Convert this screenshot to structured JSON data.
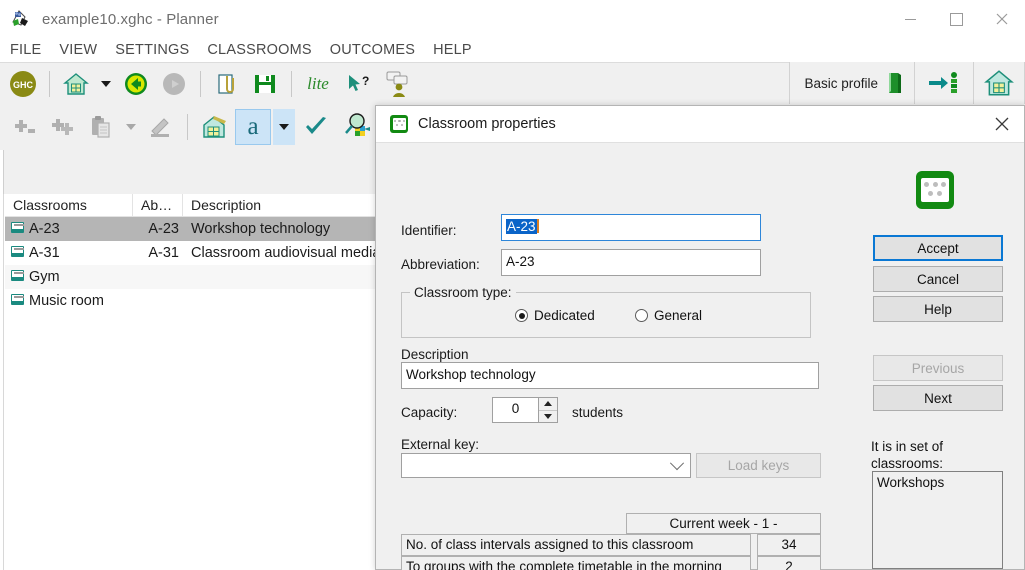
{
  "window": {
    "title": "example10.xghc - Planner",
    "app_icon": "planner-app-icon",
    "controls": {
      "minimize": "minimize",
      "maximize": "maximize",
      "close": "close"
    }
  },
  "menu": {
    "items": [
      {
        "label": "FILE"
      },
      {
        "label": "VIEW"
      },
      {
        "label": "SETTINGS"
      },
      {
        "label": "CLASSROOMS"
      },
      {
        "label": "OUTCOMES"
      },
      {
        "label": "HELP"
      }
    ]
  },
  "toolbar_top": {
    "items": [
      {
        "name": "ghc-logo-button",
        "label": "GHC"
      },
      {
        "name": "home-button",
        "label": ""
      },
      {
        "name": "home-dropdown-caret",
        "label": ""
      },
      {
        "name": "back-button",
        "label": ""
      },
      {
        "name": "forward-button-disabled",
        "label": ""
      },
      {
        "name": "attach-button",
        "label": ""
      },
      {
        "name": "save-button",
        "label": ""
      },
      {
        "name": "lite-button",
        "label": "lite"
      },
      {
        "name": "help-pointer-button",
        "label": ""
      },
      {
        "name": "comments-user-button",
        "label": ""
      }
    ],
    "profile_label": "Basic profile"
  },
  "toolbar_second": {
    "items": [
      {
        "name": "add-button-disabled"
      },
      {
        "name": "add-multiple-button-disabled"
      },
      {
        "name": "paste-button-disabled"
      },
      {
        "name": "paste-dropdown-caret-disabled"
      },
      {
        "name": "edit-hand-button-disabled"
      },
      {
        "name": "classroom-house-button"
      },
      {
        "name": "text-a-button",
        "label": "a"
      },
      {
        "name": "text-a-dropdown-caret"
      },
      {
        "name": "confirm-check-button"
      },
      {
        "name": "search-grid-button"
      }
    ]
  },
  "listview": {
    "columns": [
      {
        "label": "Classrooms"
      },
      {
        "label": "Ab…"
      },
      {
        "label": "Description"
      }
    ],
    "rows": [
      {
        "classroom": "A-23",
        "abbrev": "A-23",
        "description": "Workshop technology",
        "selected": true
      },
      {
        "classroom": "A-31",
        "abbrev": "A-31",
        "description": "Classroom audiovisual media",
        "selected": false
      },
      {
        "classroom": "Gym",
        "abbrev": "",
        "description": "",
        "selected": false
      },
      {
        "classroom": "Music room",
        "abbrev": "",
        "description": "",
        "selected": false
      }
    ]
  },
  "dialog": {
    "title": "Classroom properties",
    "icon": "classroom-icon",
    "close_label": "✕",
    "fields": {
      "identifier_label": "Identifier:",
      "identifier_value": "A-23",
      "abbreviation_label": "Abbreviation:",
      "abbreviation_value": "A-23",
      "classroom_type_label": "Classroom type:",
      "type_dedicated": "Dedicated",
      "type_general": "General",
      "description_label": "Description",
      "description_value": "Workshop technology",
      "capacity_label": "Capacity:",
      "capacity_value": "0",
      "capacity_unit": "students",
      "external_key_label": "External key:",
      "external_key_value": "",
      "load_keys_label": "Load keys"
    },
    "buttons": {
      "accept": "Accept",
      "cancel": "Cancel",
      "help": "Help",
      "previous": "Previous",
      "next": "Next"
    },
    "set_of_classrooms": {
      "label": "It is in set of classrooms:",
      "items": [
        "Workshops"
      ]
    },
    "stats": {
      "header": "Current week - 1 -",
      "rows": [
        {
          "label": "No. of class intervals assigned to this classroom",
          "value": "34"
        },
        {
          "label": "To groups with the complete timetable in the morning",
          "value": "2"
        }
      ]
    }
  },
  "colors": {
    "accent_blue": "#0a78d4",
    "selection_blue": "#0a64c8",
    "green": "#128a12",
    "toolbar_bg": "#f0f0f0",
    "row_selected": "#b5b5b5"
  }
}
